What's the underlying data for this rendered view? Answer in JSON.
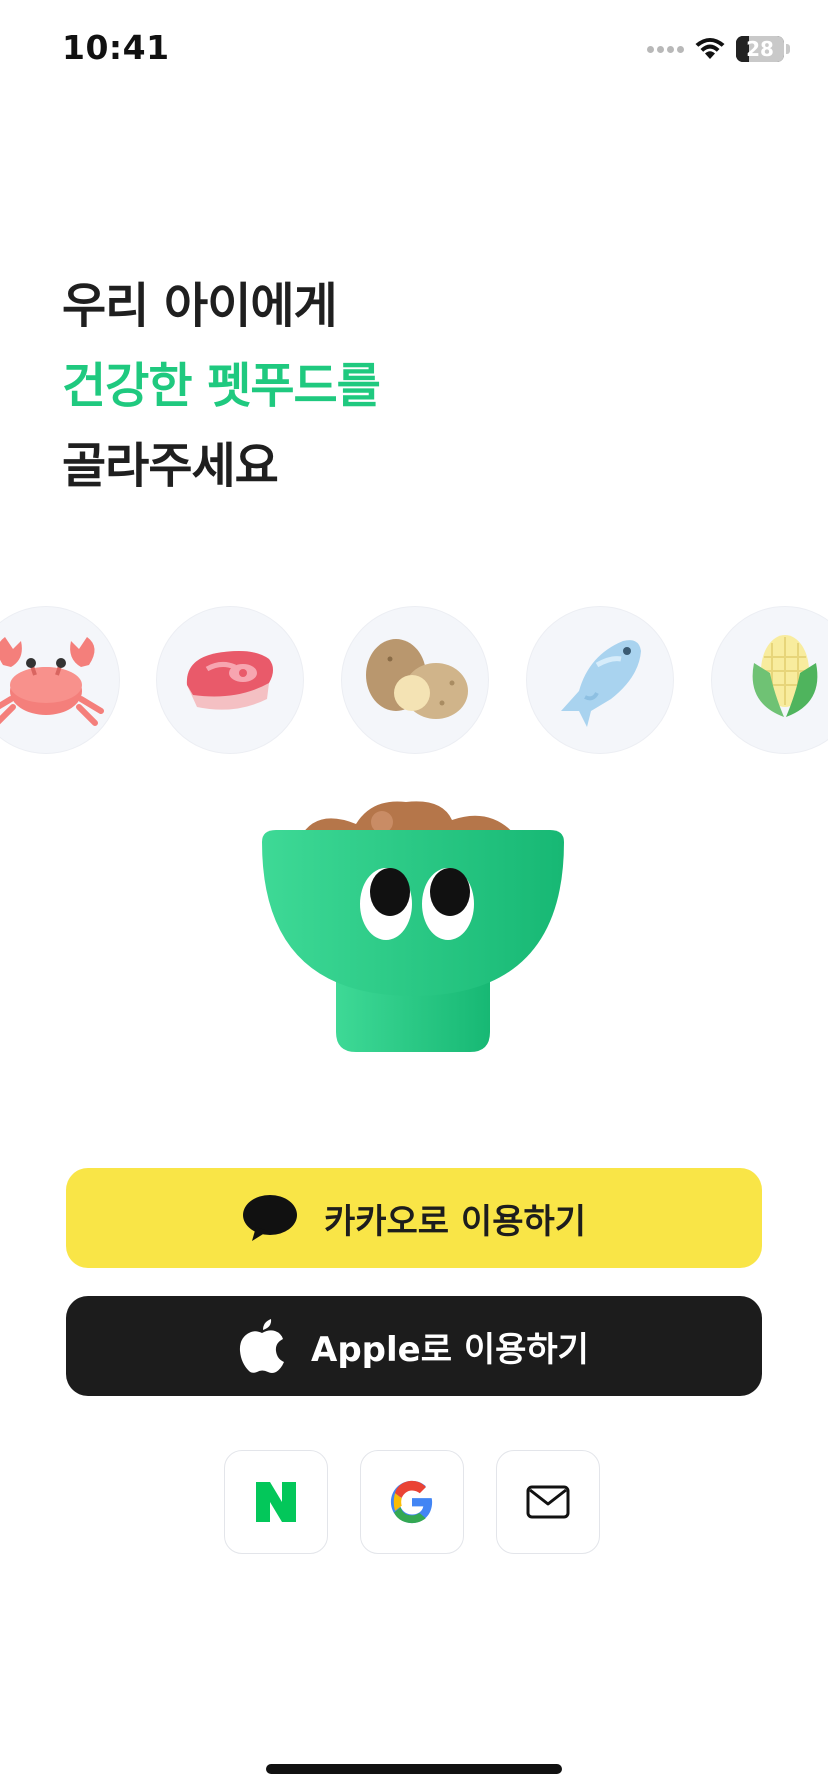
{
  "status_bar": {
    "time": "10:41",
    "battery_level": "28",
    "battery_fraction": 0.28
  },
  "headline": {
    "line1": "우리 아이에게",
    "line2": "건강한 펫푸드를",
    "line3": "골라주세요",
    "accent_color": "#1fc97f"
  },
  "ingredients": [
    {
      "icon": "crab-icon"
    },
    {
      "icon": "meat-icon"
    },
    {
      "icon": "potato-icon"
    },
    {
      "icon": "fish-icon"
    },
    {
      "icon": "corn-icon"
    }
  ],
  "mascot": {
    "icon": "food-bowl-mascot-icon",
    "color": "#22c47e"
  },
  "buttons": {
    "kakao": {
      "label": "카카오로 이용하기",
      "color": "#f9e547"
    },
    "apple": {
      "label": "Apple로 이용하기",
      "color": "#1c1c1c"
    }
  },
  "social": [
    {
      "icon": "naver-icon",
      "letter": "N",
      "color": "#03c75a"
    },
    {
      "icon": "google-icon"
    },
    {
      "icon": "mail-icon"
    }
  ]
}
